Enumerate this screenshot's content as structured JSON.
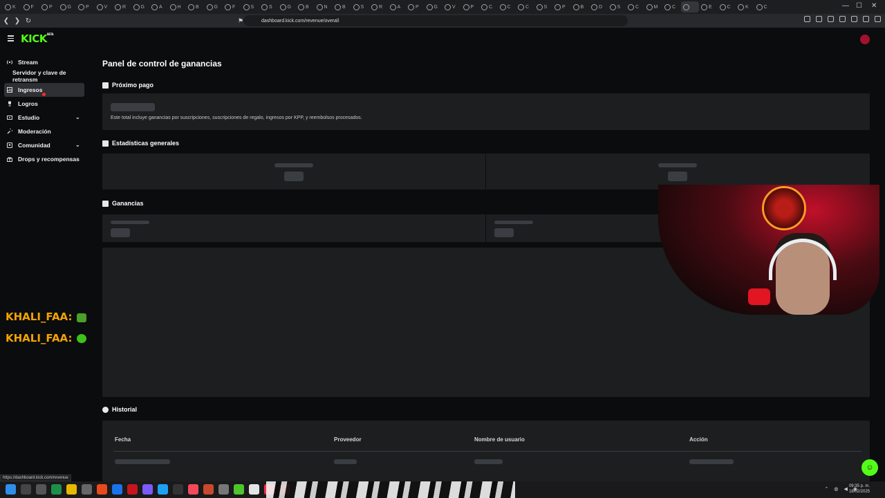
{
  "browser": {
    "url": "dashboard.kick.com/revenue/overall",
    "tabs": [
      {
        "label": "K"
      },
      {
        "label": "F"
      },
      {
        "label": "P"
      },
      {
        "label": "G"
      },
      {
        "label": "P"
      },
      {
        "label": "V"
      },
      {
        "label": "R"
      },
      {
        "label": "G"
      },
      {
        "label": "A"
      },
      {
        "label": "H"
      },
      {
        "label": "B"
      },
      {
        "label": "G"
      },
      {
        "label": "F"
      },
      {
        "label": "S"
      },
      {
        "label": "S"
      },
      {
        "label": "G"
      },
      {
        "label": "B"
      },
      {
        "label": "N"
      },
      {
        "label": "B"
      },
      {
        "label": "S"
      },
      {
        "label": "R"
      },
      {
        "label": "A"
      },
      {
        "label": "P"
      },
      {
        "label": "G"
      },
      {
        "label": "V"
      },
      {
        "label": "P"
      },
      {
        "label": "C"
      },
      {
        "label": "C"
      },
      {
        "label": "C"
      },
      {
        "label": "S"
      },
      {
        "label": "P"
      },
      {
        "label": "B"
      },
      {
        "label": "D"
      },
      {
        "label": "S"
      },
      {
        "label": "C"
      },
      {
        "label": "M"
      },
      {
        "label": "C"
      },
      {
        "label": "",
        "active": true
      },
      {
        "label": "E"
      },
      {
        "label": "C"
      },
      {
        "label": "K"
      },
      {
        "label": "C"
      }
    ],
    "status_url": "https://dashboard.kick.com/revenue"
  },
  "app": {
    "logo": "KICK",
    "logo_tag": "BETA"
  },
  "sidebar": {
    "items": [
      {
        "label": "Stream",
        "icon": "broadcast-icon"
      },
      {
        "label": "Servidor y clave de retransm",
        "sub": true
      },
      {
        "label": "Ingresos",
        "icon": "chart-icon",
        "active": true
      },
      {
        "label": "Logros",
        "icon": "trophy-icon"
      },
      {
        "label": "Estudio",
        "icon": "studio-icon",
        "expandable": true
      },
      {
        "label": "Moderación",
        "icon": "wrench-icon"
      },
      {
        "label": "Comunidad",
        "icon": "community-icon",
        "expandable": true
      },
      {
        "label": "Drops y recompensas",
        "icon": "gift-icon"
      }
    ]
  },
  "overlay": {
    "names": [
      "KHALI_FAA:",
      "KHALI_FAA:"
    ]
  },
  "main": {
    "title": "Panel de control de ganancias",
    "next_payment": {
      "title": "Próximo pago",
      "description": "Este total incluye ganancias por suscripciones, suscripciones de regalo, ingresos por KPP, y reembolsos procesados."
    },
    "stats": {
      "title": "Estadísticas generales"
    },
    "earnings": {
      "title": "Ganancias"
    },
    "history": {
      "title": "Historial",
      "columns": [
        "Fecha",
        "Proveedor",
        "Nombre de usuario",
        "Acción"
      ]
    }
  },
  "taskbar": {
    "clock_time": "09:35 p. m.",
    "clock_date": "18/02/2025"
  },
  "colors": {
    "accent": "#53fc18",
    "card_bg": "#1c1e20",
    "page_bg": "#0b0c0d",
    "skeleton": "#3a3d41"
  }
}
